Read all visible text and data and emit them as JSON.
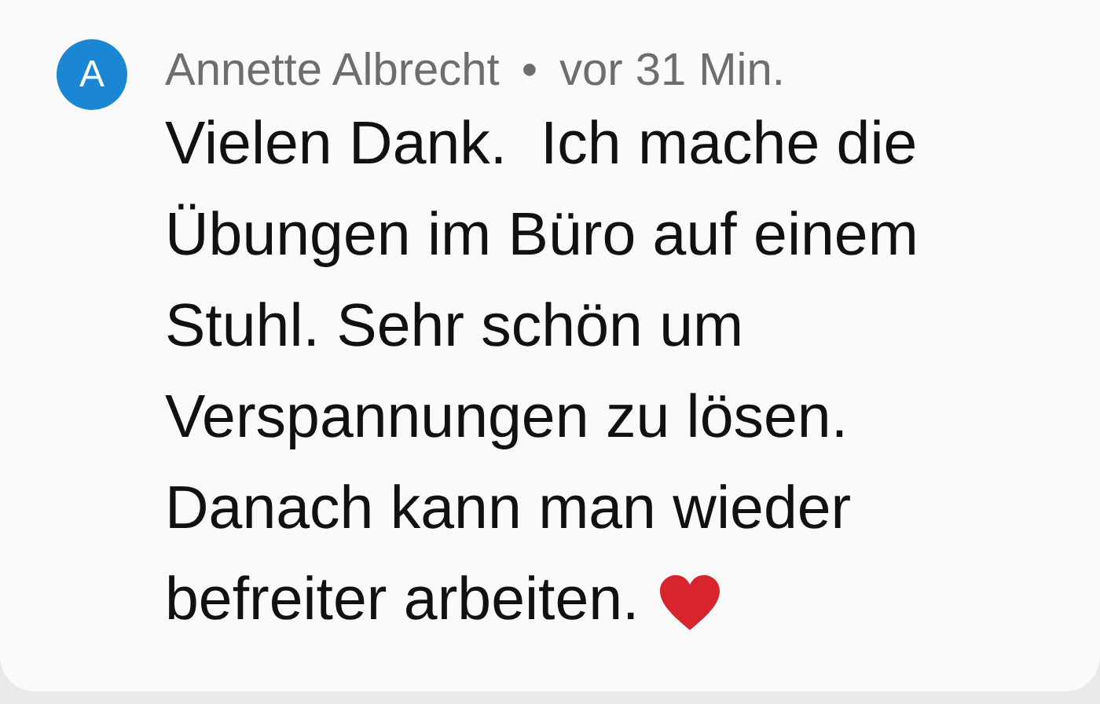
{
  "comment": {
    "avatar": "A",
    "author": "Annette Albrecht",
    "separator": "•",
    "time": "vor 31 Min.",
    "text": "Vielen Dank.  Ich mache die Übungen im Büro auf einem Stuhl. Sehr schön um Verspannungen zu lösen. Danach kann man wieder",
    "text_end": "befreiter arbeiten."
  }
}
